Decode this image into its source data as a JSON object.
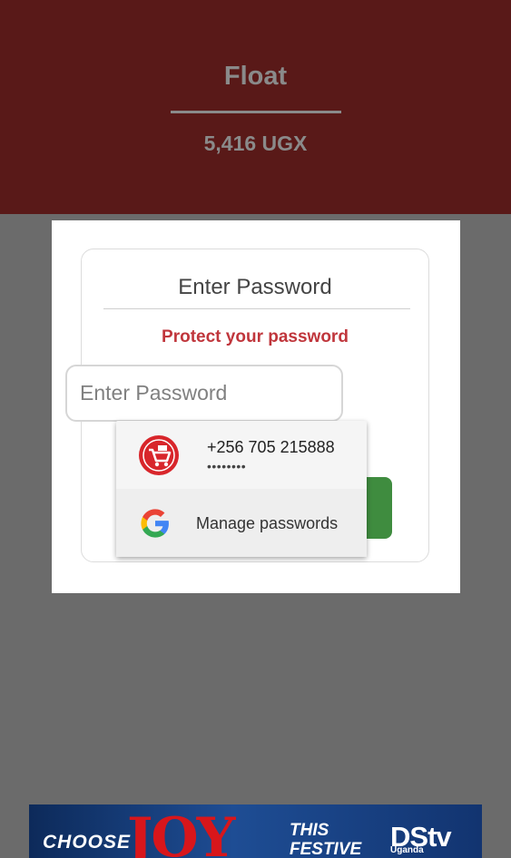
{
  "header": {
    "title": "Float",
    "amount": "5,416 UGX"
  },
  "dialog": {
    "title": "Enter Password",
    "warning": "Protect your password",
    "password_input": {
      "placeholder": "Enter Password",
      "value": ""
    }
  },
  "autofill": {
    "account_phone": "+256 705 215888",
    "account_masked_password": "••••••••",
    "manage_label": "Manage passwords"
  },
  "banner": {
    "choose": "CHOOSE",
    "joy": "JOY",
    "this": "THIS",
    "festive": "FESTIVE",
    "brand": "DStv",
    "brand_region": "Uganda"
  },
  "colors": {
    "header_bg": "#591918",
    "warning_text": "#c0363c",
    "button_green": "#3f8c3f",
    "overlay": "#6b6b6b"
  }
}
